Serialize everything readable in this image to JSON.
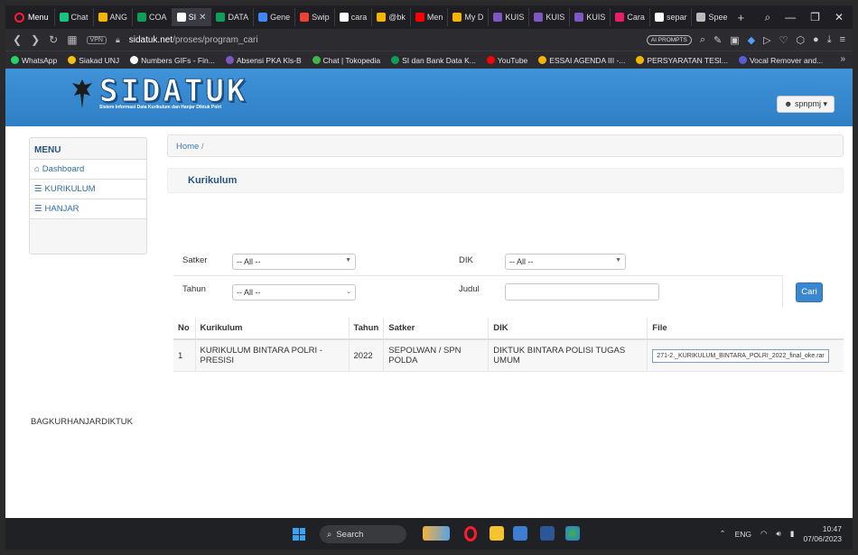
{
  "browser": {
    "menu_label": "Menu",
    "tabs": [
      {
        "label": "Chat",
        "color": "#19c37d"
      },
      {
        "label": "ANG",
        "color": "#f5b400"
      },
      {
        "label": "COA",
        "color": "#0f9d58"
      },
      {
        "label": "SI",
        "color": "#ffffff",
        "active": true
      },
      {
        "label": "DATA",
        "color": "#0f9d58"
      },
      {
        "label": "Gene",
        "color": "#4285f4"
      },
      {
        "label": "Swip",
        "color": "#ea4335"
      },
      {
        "label": "cara",
        "color": "#ffffff"
      },
      {
        "label": "@bk",
        "color": "#f4b400"
      },
      {
        "label": "Men",
        "color": "#ff0000"
      },
      {
        "label": "My D",
        "color": "#f5b400"
      },
      {
        "label": "KUIS",
        "color": "#7e57c2"
      },
      {
        "label": "KUIS",
        "color": "#7e57c2"
      },
      {
        "label": "KUIS",
        "color": "#7e57c2"
      },
      {
        "label": "Cara",
        "color": "#e91e63"
      },
      {
        "label": "separ",
        "color": "#ffffff"
      },
      {
        "label": "Spee",
        "color": "#bbbbbb"
      }
    ],
    "new_tab": "+",
    "vpn": "VPN",
    "url_host": "sidatuk.net",
    "url_path": "/proses/program_cari",
    "ai_prompts": "AI PROMPTS",
    "bookmarks": [
      {
        "label": "WhatsApp",
        "color": "#25d366"
      },
      {
        "label": "Siakad UNJ",
        "color": "#f4c20d"
      },
      {
        "label": "Numbers GIFs - Fin...",
        "color": "#ffffff"
      },
      {
        "label": "Absensi PKA Kls-B",
        "color": "#7e57c2"
      },
      {
        "label": "Chat | Tokopedia",
        "color": "#42b549"
      },
      {
        "label": "SI dan Bank Data K...",
        "color": "#0f9d58"
      },
      {
        "label": "YouTube",
        "color": "#ff0000"
      },
      {
        "label": "ESSAI AGENDA III -...",
        "color": "#f5b400"
      },
      {
        "label": "PERSYARATAN TESI...",
        "color": "#f4b400"
      },
      {
        "label": "Vocal Remover and...",
        "color": "#5b5bd6"
      }
    ],
    "bookmarks_more": "»"
  },
  "site": {
    "logo_text": "SIDATUK",
    "logo_subtitle": "Sistem Informasi Data Kurikulum dan Hanjar Diktuk Polri",
    "user_label": "spnpmj",
    "menu_title": "MENU",
    "menu_items": [
      {
        "label": "Dashboard",
        "icon": "home-icon"
      },
      {
        "label": "KURIKULUM",
        "icon": "list-icon"
      },
      {
        "label": "HANJAR",
        "icon": "list-icon"
      }
    ],
    "breadcrumb_home": "Home",
    "breadcrumb_sep": "/",
    "section_title": "Kurikulum"
  },
  "filters": {
    "satker_label": "Satker",
    "satker_value": "-- All --",
    "dik_label": "DIK",
    "dik_value": "-- All --",
    "tahun_label": "Tahun",
    "tahun_value": "-- All --",
    "judul_label": "Judul",
    "judul_value": "",
    "search_button": "Cari"
  },
  "table": {
    "headers": [
      "No",
      "Kurikulum",
      "Tahun",
      "Satker",
      "DIK",
      "File"
    ],
    "rows": [
      {
        "no": "1",
        "kurikulum": "KURIKULUM BINTARA POLRI - PRESISI",
        "tahun": "2022",
        "satker": "SEPOLWAN / SPN POLDA",
        "dik": "DIKTUK BINTARA POLISI TUGAS UMUM",
        "file": "271-2._KURIKULUM_BINTARA_POLRI_2022_final_oke.rar"
      }
    ]
  },
  "footer_text": "BAGKURHANJARDIKTUK",
  "taskbar": {
    "search_label": "Search",
    "lang": "ENG",
    "time": "10:47",
    "date": "07/06/2023"
  }
}
